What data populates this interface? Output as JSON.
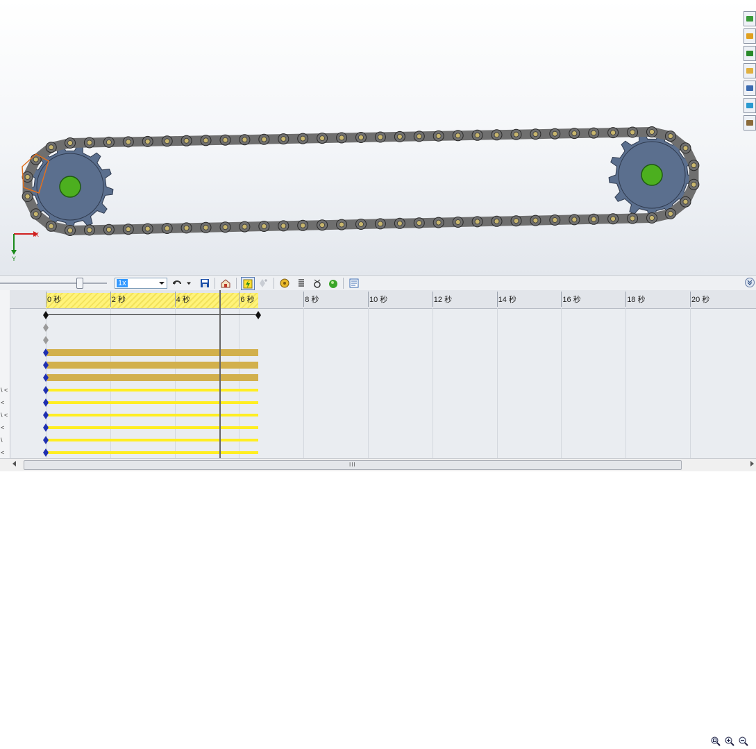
{
  "viewport": {
    "axis_x_label": "X",
    "axis_y_label": "Y",
    "background_top": "#ffffff",
    "background_bottom": "#e3e7ed",
    "sprocket_color": "#5b6f8e",
    "hub_color": "#4caf1f",
    "chain_color": "#6f6f6f",
    "chain_pin_color": "#c8b66e",
    "selection_color": "#e07020"
  },
  "task_pane": {
    "icons": [
      "resources-icon",
      "home-icon",
      "design-library-icon",
      "file-explorer-icon",
      "view-palette-icon",
      "appearances-icon",
      "custom-properties-icon"
    ]
  },
  "toolbar": {
    "playback_speed": "1x",
    "icons": [
      "playback-mode-icon",
      "save-animation-icon",
      "animation-wizard-icon",
      "calculate-icon",
      "add-key-icon",
      "motor-icon",
      "spring-icon",
      "contact-icon",
      "gravity-icon",
      "results-icon"
    ],
    "collapse_icon": "collapse-chevron-icon"
  },
  "timeline": {
    "ruler_labels": [
      "0 秒",
      "2 秒",
      "4 秒",
      "6 秒",
      "8 秒",
      "10 秒",
      "12 秒",
      "14 秒",
      "16 秒",
      "18 秒",
      "20 秒"
    ],
    "highlight_end_seconds": 6.6,
    "current_time_seconds": 5.4,
    "tree_markers": [
      "\\ <",
      "<",
      "\\ <",
      "<",
      "\\",
      "<"
    ],
    "tracks": [
      {
        "type": "key",
        "end": 6.6,
        "key_color": "#111111"
      },
      {
        "type": "key-gray",
        "key_color": "#9a9a9a"
      },
      {
        "type": "key-gray",
        "key_color": "#9a9a9a"
      },
      {
        "type": "orange",
        "end": 6.6,
        "key_color": "#2030b0"
      },
      {
        "type": "orange",
        "end": 6.6,
        "key_color": "#2030b0"
      },
      {
        "type": "orange",
        "end": 6.6,
        "key_color": "#2030b0"
      },
      {
        "type": "yellow",
        "end": 6.6,
        "key_color": "#2030b0"
      },
      {
        "type": "yellow",
        "end": 6.6,
        "key_color": "#2030b0"
      },
      {
        "type": "yellow",
        "end": 6.6,
        "key_color": "#2030b0"
      },
      {
        "type": "yellow",
        "end": 6.6,
        "key_color": "#2030b0"
      },
      {
        "type": "yellow",
        "end": 6.6,
        "key_color": "#2030b0"
      },
      {
        "type": "yellow",
        "end": 6.6,
        "key_color": "#2030b0"
      }
    ],
    "zoom_icons": [
      "zoom-fit-icon",
      "zoom-in-icon",
      "zoom-out-icon"
    ]
  },
  "scrollbar": {
    "grip": "III"
  }
}
